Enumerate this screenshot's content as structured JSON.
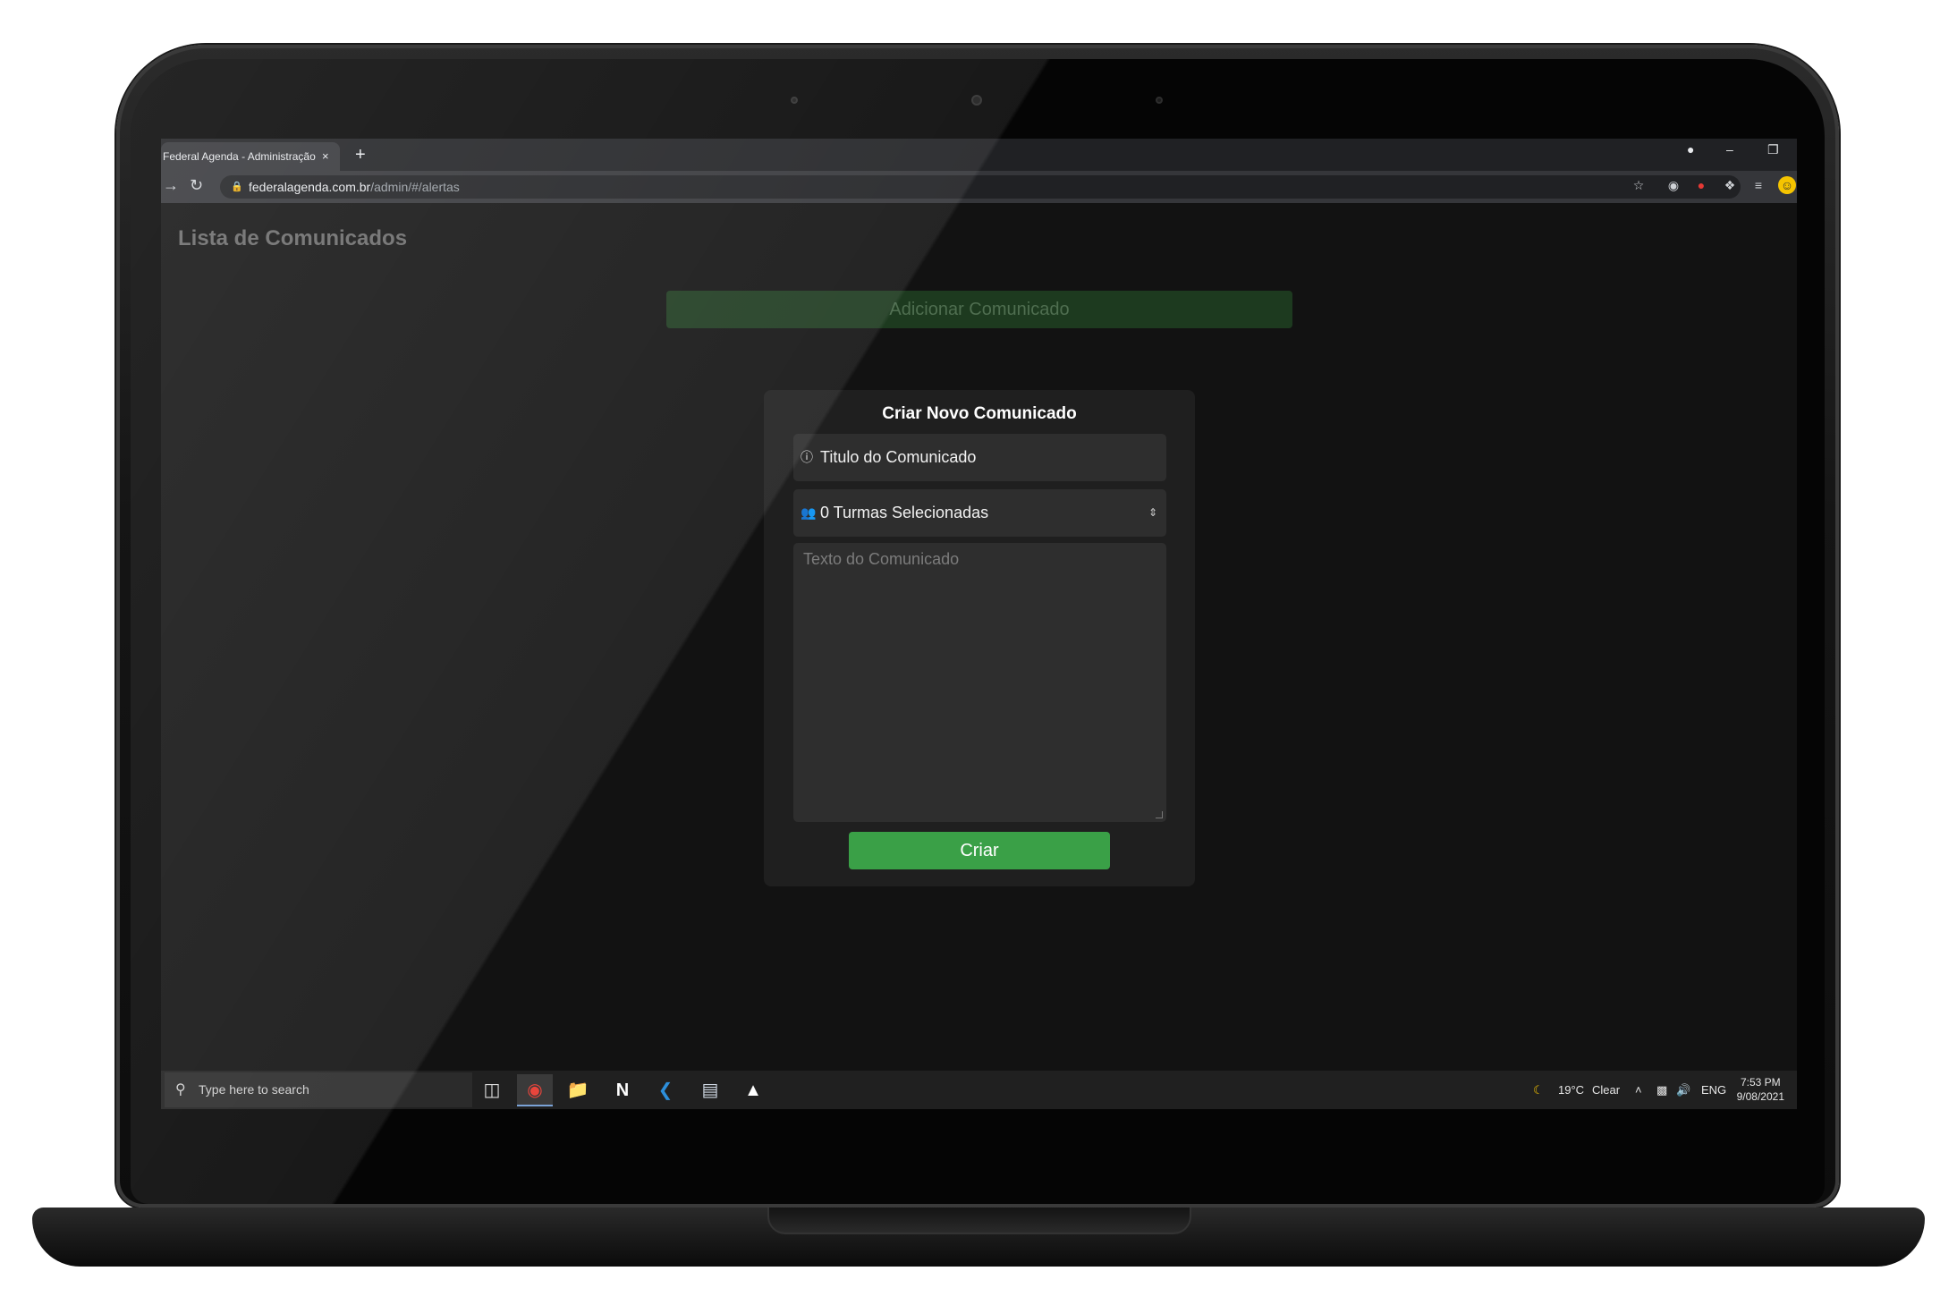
{
  "browser": {
    "tab_title": "Federal Agenda - Administração",
    "tab_close": "×",
    "new_tab": "+",
    "url_domain": "federalagenda.com.br",
    "url_path": "/admin/#/alertas"
  },
  "page": {
    "title": "Lista de Comunicados",
    "add_button": "Adicionar Comunicado"
  },
  "modal": {
    "title": "Criar Novo Comunicado",
    "title_placeholder": "Titulo do Comunicado",
    "turmas_value": "0 Turmas Selecionadas",
    "text_placeholder": "Texto do Comunicado",
    "submit_label": "Criar"
  },
  "taskbar": {
    "search_placeholder": "Type here to search",
    "weather_temp": "19°C",
    "weather_desc": "Clear",
    "language": "ENG",
    "time": "7:53 PM",
    "date": "9/08/2021"
  },
  "colors": {
    "accent_green": "#3aa047",
    "dim_green": "#1d3a1f",
    "page_bg": "#121212",
    "modal_bg": "#1f1f1f"
  }
}
